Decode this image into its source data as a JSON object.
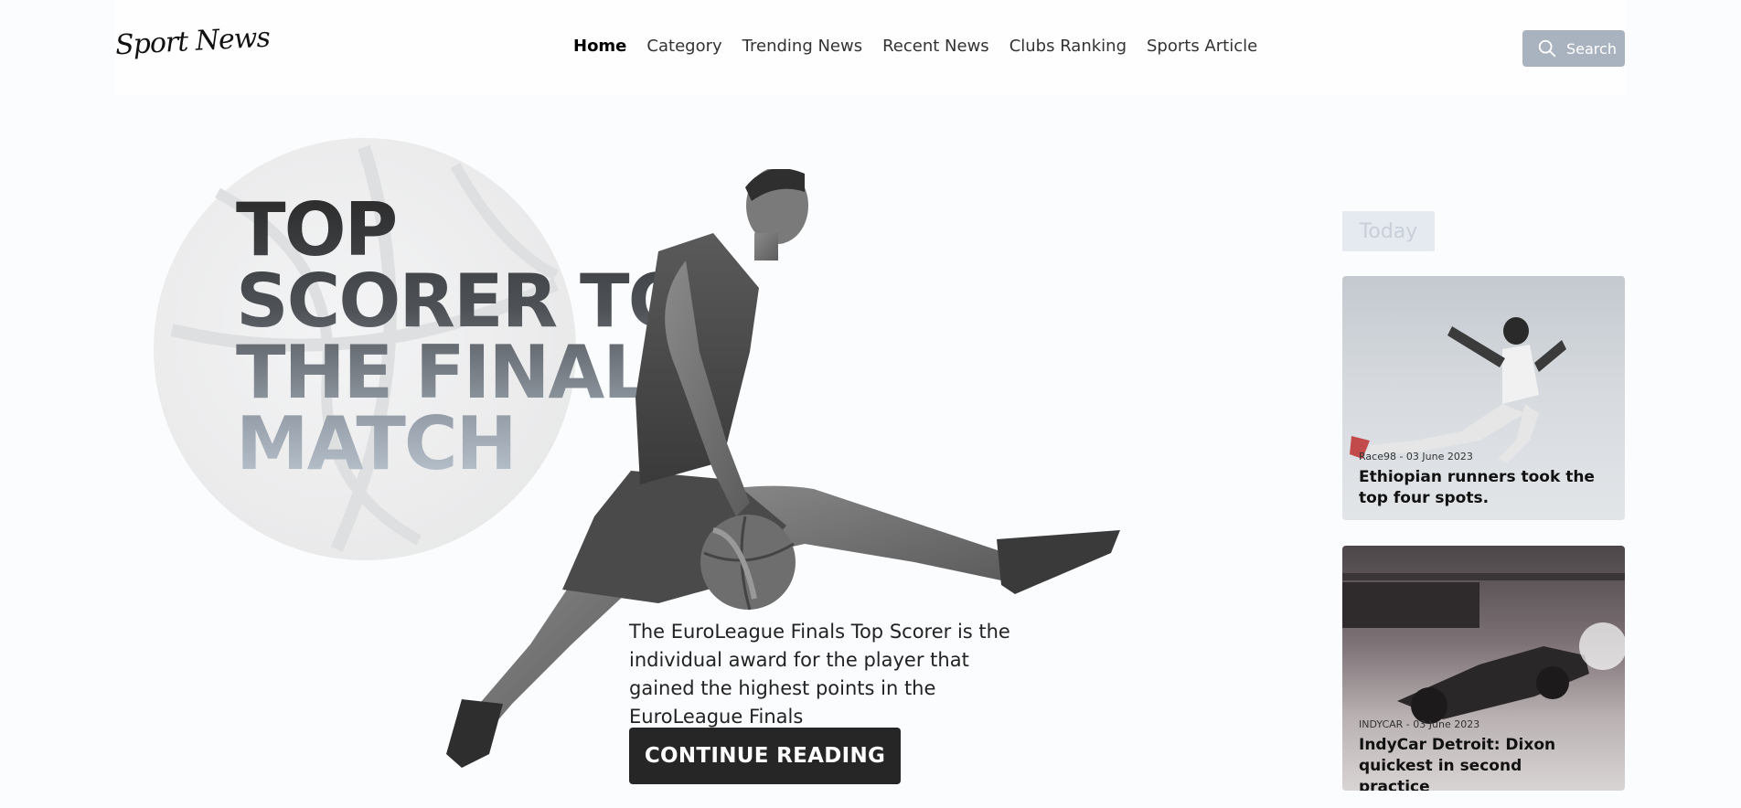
{
  "header": {
    "logo": "Sport News",
    "nav": [
      {
        "label": "Home",
        "active": true
      },
      {
        "label": "Category",
        "active": false
      },
      {
        "label": "Trending News",
        "active": false
      },
      {
        "label": "Recent News",
        "active": false
      },
      {
        "label": "Clubs Ranking",
        "active": false
      },
      {
        "label": "Sports Article",
        "active": false
      }
    ],
    "search_label": "Search",
    "search_icon": "search-icon"
  },
  "hero": {
    "title_lines": [
      "TOP",
      "SCORER TO",
      "THE FINAL",
      "MATCH"
    ],
    "description": "The EuroLeague Finals Top Scorer is the individual award for the player that gained the highest points in the EuroLeague Finals",
    "cta_label": "CONTINUE READING"
  },
  "sidebar": {
    "badge": "Today",
    "cards": [
      {
        "meta": "Race98 - 03 June 2023",
        "title": "Ethiopian runners took the top four spots."
      },
      {
        "meta": "INDYCAR - 03 June 2023",
        "title": "IndyCar Detroit: Dixon quickest in second practice"
      }
    ]
  },
  "colors": {
    "accent_dark": "#262626",
    "search_bg": "#a9b3bf",
    "badge_bg": "#e5eaf0"
  }
}
